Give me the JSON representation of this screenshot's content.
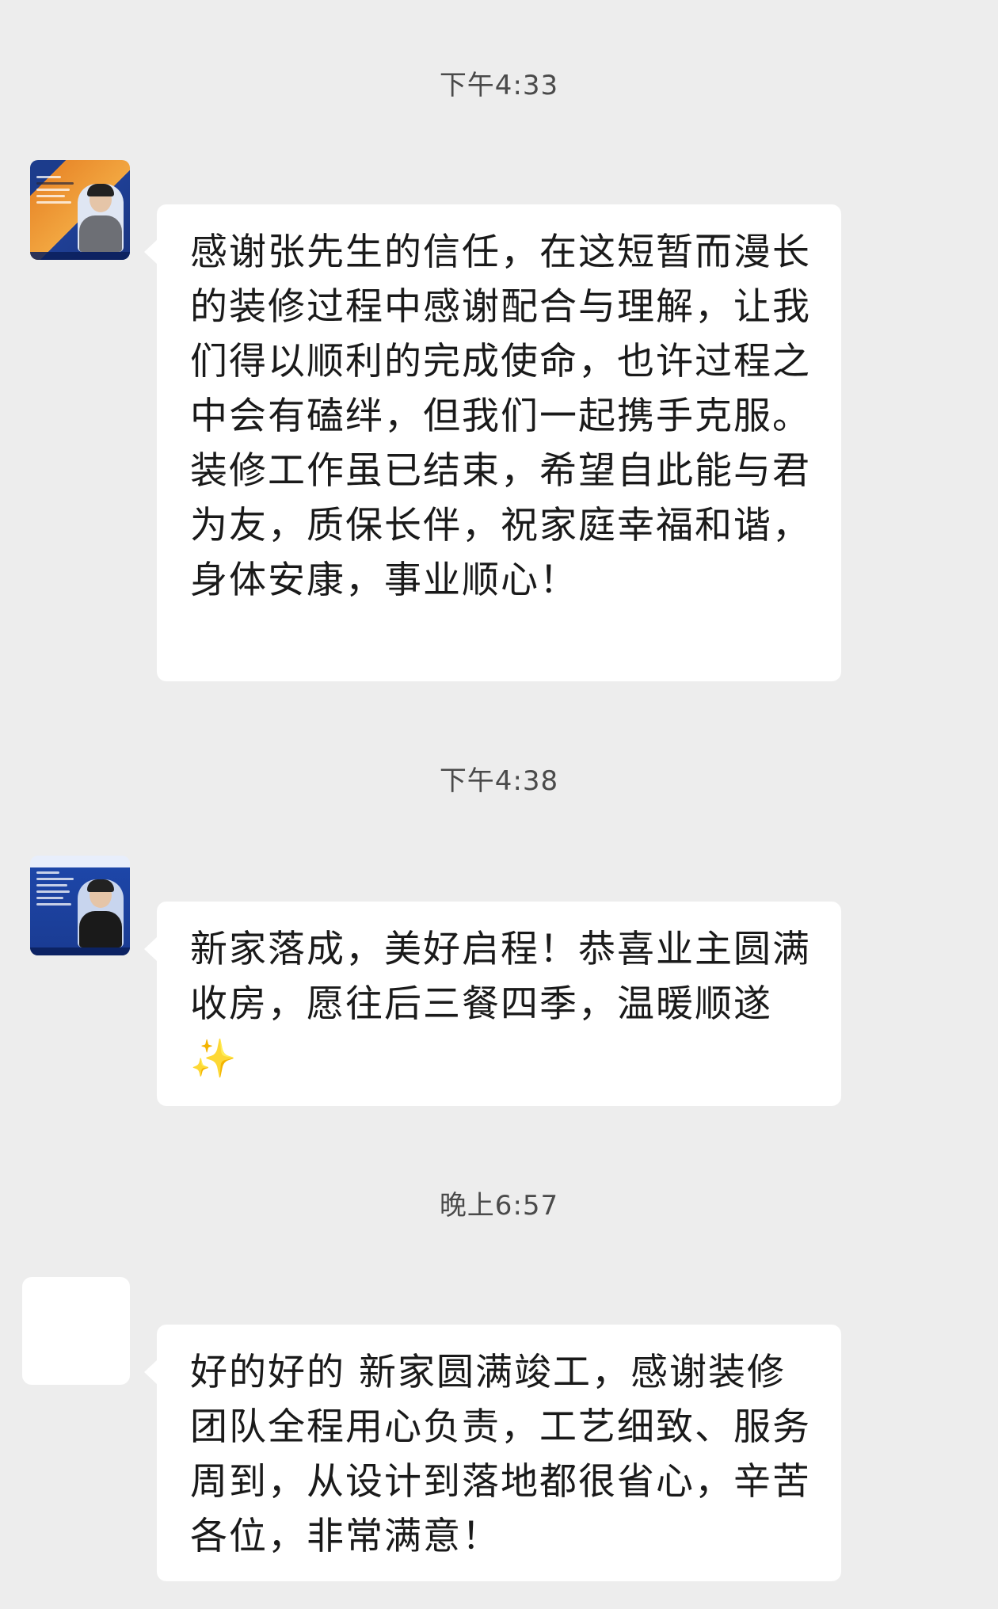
{
  "messages": [
    {
      "timestamp": "下午4:33",
      "text": "感谢张先生的信任，在这短暂而漫长的装修过程中感谢配合与理解，让我们得以顺利的完成使命，也许过程之中会有磕绊，但我们一起携手克服。\n装修工作虽已结束，希望自此能与君为友，质保长伴，祝家庭幸福和谐，身体安康，事业顺心！",
      "avatar": "orange-business-card-avatar"
    },
    {
      "timestamp": "下午4:38",
      "text": "新家落成，美好启程！恭喜业主圆满收房，愿往后三餐四季，温暖顺遂",
      "emoji": "✨",
      "avatar": "blue-business-card-avatar"
    },
    {
      "timestamp": "晚上6:57",
      "text": "好的好的 新家圆满竣工，感谢装修团队全程用心负责，工艺细致、服务周到，从设计到落地都很省心，辛苦各位，非常满意！",
      "avatar": "blank-avatar"
    }
  ],
  "colors": {
    "background": "#ededed",
    "bubble": "#ffffff",
    "text": "#1a1a1a",
    "timestamp": "#4a4a4a"
  }
}
